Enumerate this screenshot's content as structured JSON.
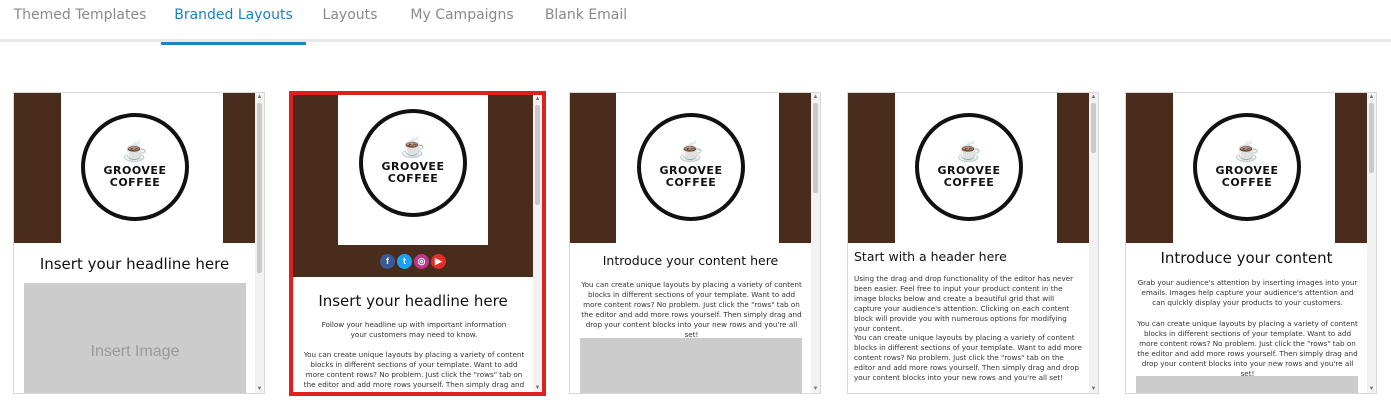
{
  "tabs": [
    {
      "label": "Themed Templates",
      "active": false
    },
    {
      "label": "Branded Layouts",
      "active": true
    },
    {
      "label": "Layouts",
      "active": false
    },
    {
      "label": "My Campaigns",
      "active": false
    },
    {
      "label": "Blank Email",
      "active": false
    }
  ],
  "colors": {
    "accent": "#1b82c4",
    "brand_brown": "#4a2c1d",
    "selection": "#e02020"
  },
  "logo": {
    "line1": "GROOVEE",
    "line2": "COFFEE",
    "icon": "coffee-cup-icon"
  },
  "cards": [
    {
      "headline": "Insert your headline here",
      "image_label": "Insert Image",
      "selected": false
    },
    {
      "headline": "Insert your headline here",
      "intro": "Follow your headline up with important information your customers may need to know.",
      "body": "You can create unique layouts by placing a variety of content blocks in different sections of your template. Want to add more content rows? No problem. Just click the \"rows\" tab on the editor and add more rows yourself. Then simply drag and drop your content blocks",
      "social": [
        "facebook-icon",
        "twitter-icon",
        "instagram-icon",
        "youtube-icon"
      ],
      "selected": true
    },
    {
      "headline": "Introduce your content here",
      "body": "You can create unique layouts by placing a variety of content blocks in different sections of your template. Want to add more content rows? No problem. Just click the \"rows\" tab on the editor and add more rows yourself. Then simply drag and drop your content blocks into your new rows and you're all set!",
      "selected": false
    },
    {
      "headline": "Start with a header here",
      "body": "Using the drag and drop functionality of the editor has never been easier. Feel free to input your product content in the image blocks below and create a beautiful grid that will capture your audience's attention. Clicking on each content block will provide you with numerous options for modifying your content.",
      "body2": "You can create unique layouts by placing a variety of content blocks in different sections of your template. Want to add more content rows? No problem. Just click the \"rows\" tab on the editor and add more rows yourself. Then simply drag and drop your content blocks into your new rows and you're all set!",
      "selected": false
    },
    {
      "headline": "Introduce your content",
      "body": "Grab your audience's attention by inserting images into your emails. Images help capture your audience's attention and can quickly display your products to your customers.",
      "body2": "You can create unique layouts by placing a variety of content blocks in different sections of your template. Want to add more content rows? No problem. Just click the \"rows\" tab on the editor and add more rows yourself. Then simply drag and drop your content blocks into your new rows and you're all set!",
      "selected": false
    }
  ]
}
